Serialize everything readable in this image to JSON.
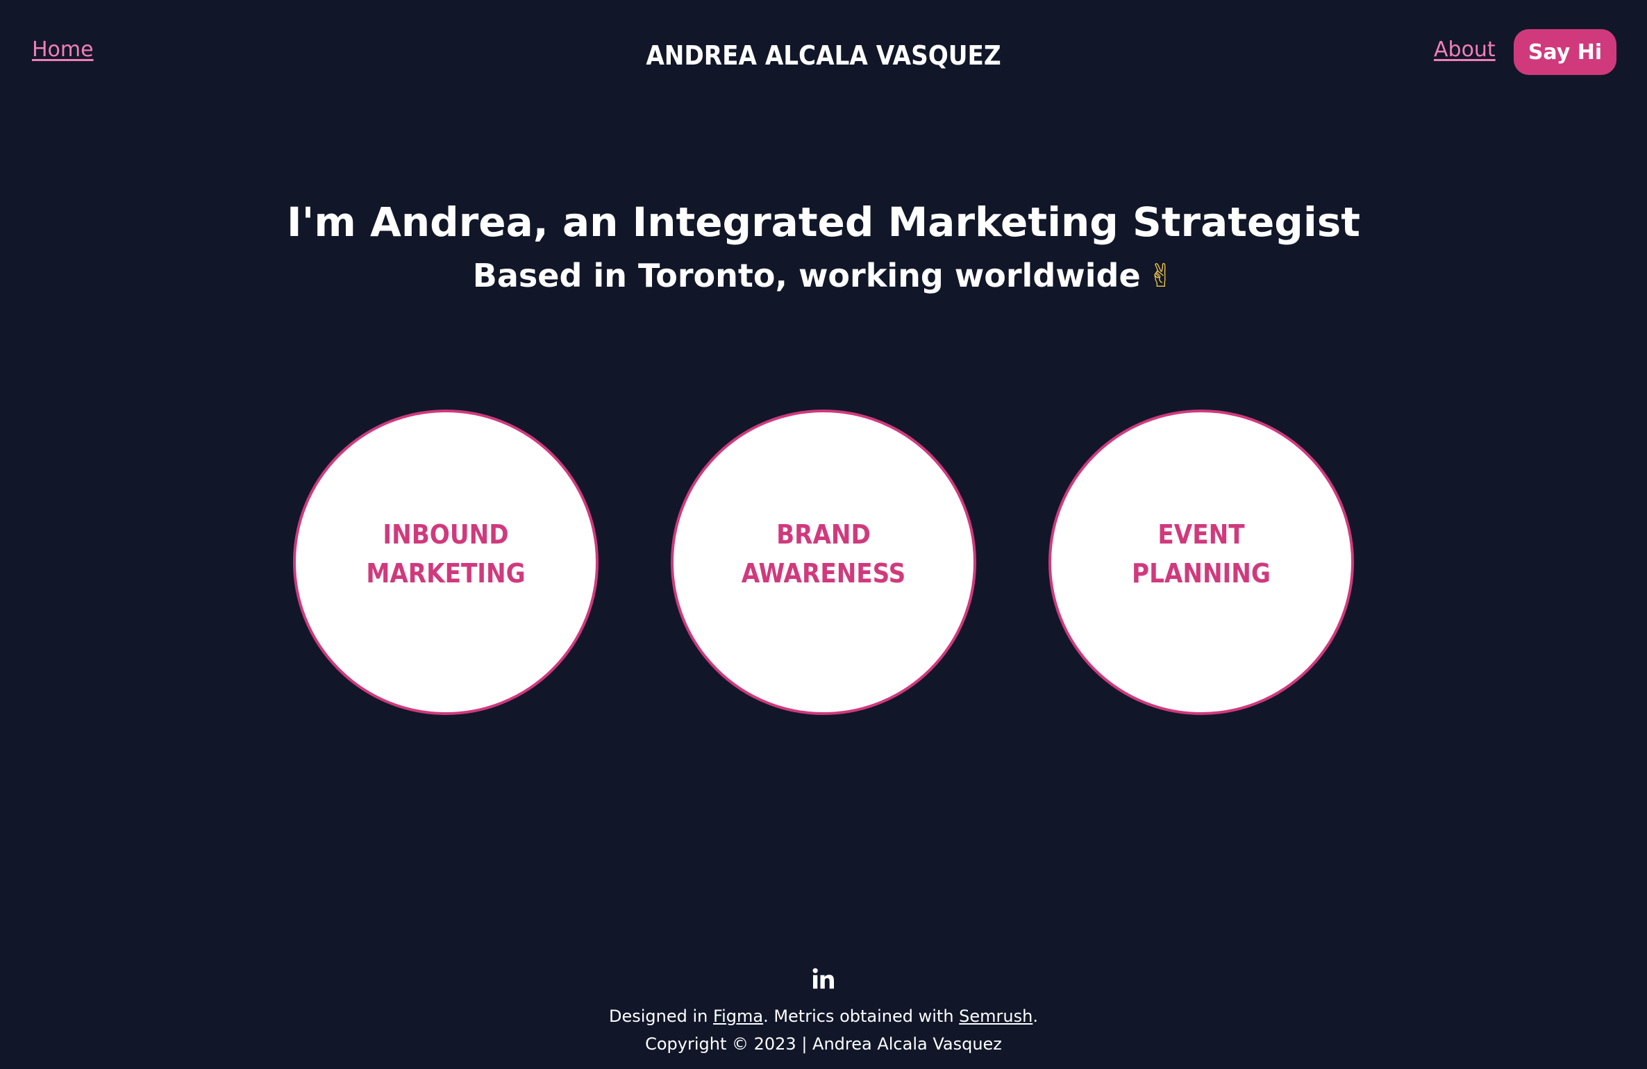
{
  "header": {
    "home_label": "Home",
    "site_title": "ANDREA ALCALA VASQUEZ",
    "about_label": "About",
    "cta_label": "Say Hi"
  },
  "hero": {
    "title": "I'm Andrea, an Integrated Marketing Strategist",
    "subtitle": "Based in Toronto, working worldwide",
    "emoji": "✌"
  },
  "services": [
    {
      "line1": "INBOUND",
      "line2": "MARKETING"
    },
    {
      "line1": "BRAND",
      "line2": "AWARENESS"
    },
    {
      "line1": "EVENT",
      "line2": "PLANNING"
    }
  ],
  "footer": {
    "social_icon": "linkedin-icon",
    "designed_prefix": "Designed in ",
    "figma_link": "Figma",
    "metrics_text": ". Metrics obtained with ",
    "semrush_link": "Semrush",
    "period": ".",
    "copyright": "Copyright © 2023 | Andrea Alcala Vasquez"
  },
  "colors": {
    "background": "#111729",
    "accent": "#d03a7d",
    "link": "#f27fb8",
    "text": "#ffffff"
  }
}
